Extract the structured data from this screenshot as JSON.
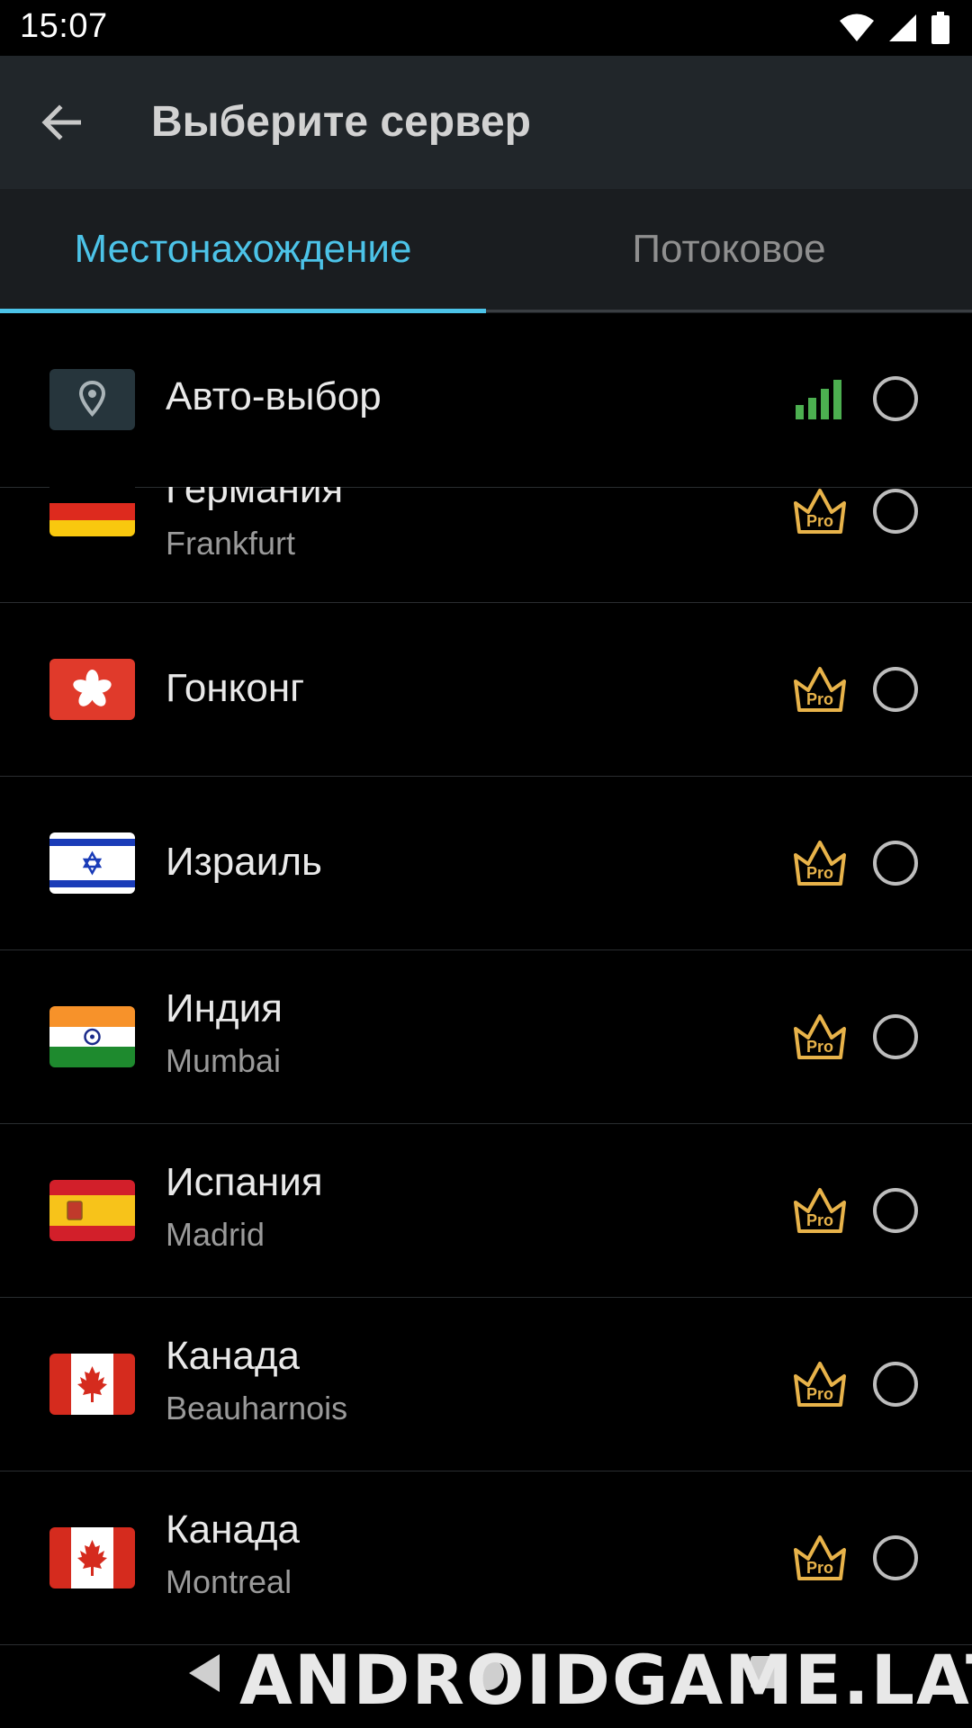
{
  "status_bar": {
    "time": "15:07"
  },
  "app_bar": {
    "title": "Выберите сервер"
  },
  "tabs": [
    {
      "label": "Местонахождение",
      "active": true
    },
    {
      "label": "Потоковое",
      "active": false
    }
  ],
  "colors": {
    "accent": "#4cc3e8",
    "pro_gold": "#e8b34a",
    "signal_green": "#4caf50"
  },
  "auto_select": {
    "label": "Авто-выбор",
    "icon": "location-pin-icon",
    "signal": "strong"
  },
  "servers": [
    {
      "country": "Германия",
      "city": "Frankfurt",
      "badge": "Pro",
      "flag": "germany"
    },
    {
      "country": "Гонконг",
      "city": "",
      "badge": "Pro",
      "flag": "hong-kong"
    },
    {
      "country": "Израиль",
      "city": "",
      "badge": "Pro",
      "flag": "israel"
    },
    {
      "country": "Индия",
      "city": "Mumbai",
      "badge": "Pro",
      "flag": "india"
    },
    {
      "country": "Испания",
      "city": "Madrid",
      "badge": "Pro",
      "flag": "spain"
    },
    {
      "country": "Канада",
      "city": "Beauharnois",
      "badge": "Pro",
      "flag": "canada"
    },
    {
      "country": "Канада",
      "city": "Montreal",
      "badge": "Pro",
      "flag": "canada"
    }
  ],
  "watermark": "ANDROIDGAME.LAT"
}
